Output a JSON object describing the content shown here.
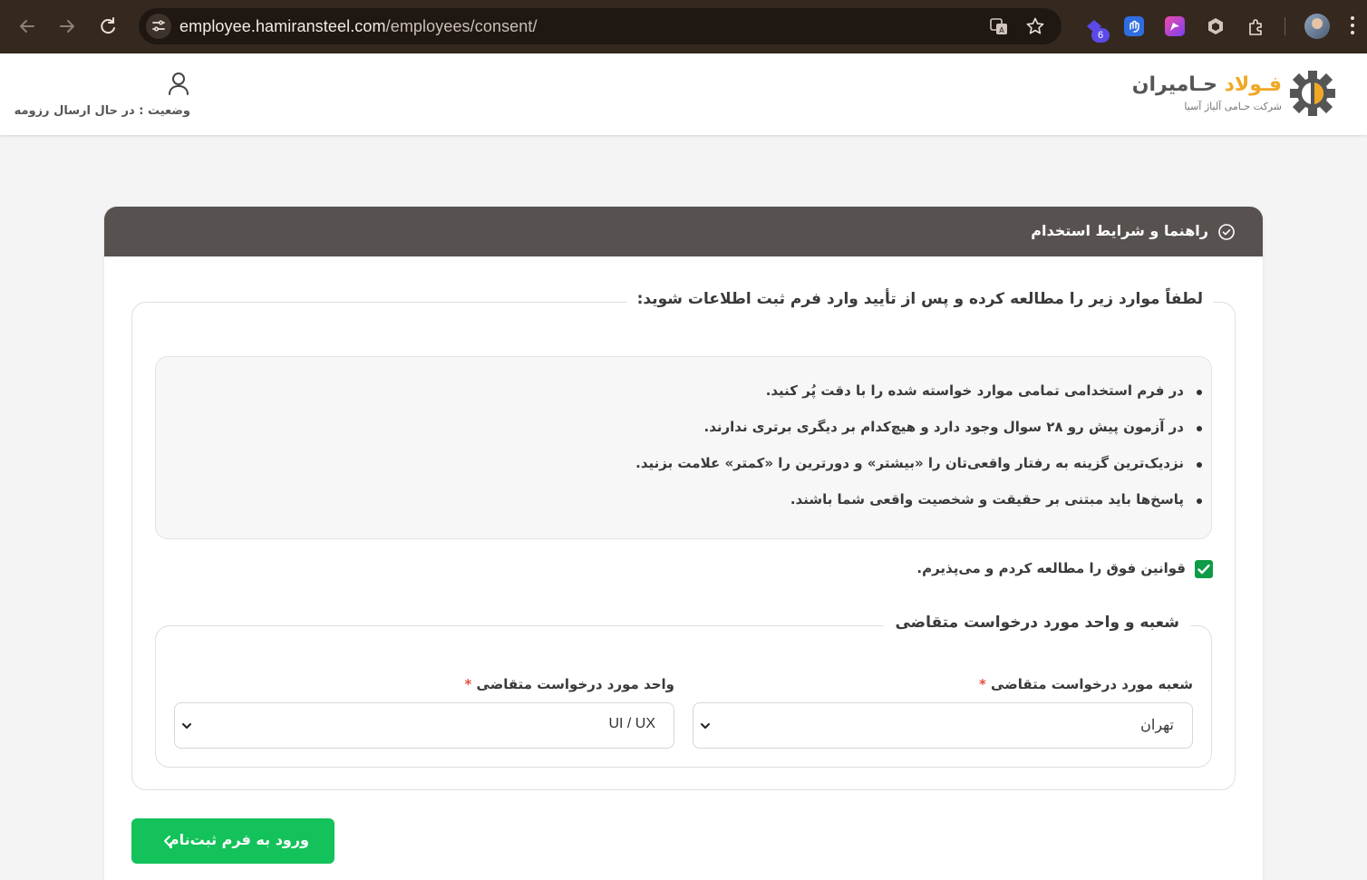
{
  "browser": {
    "url_host": "employee.hamiransteel.com",
    "url_path": "/employees/consent/",
    "extension_badge": "6"
  },
  "header": {
    "logo_title_accent": "فـولاد",
    "logo_title_rest": " حـامیران",
    "logo_subtitle": "شرکت حـامی آلیاژ آسیا",
    "user_status": "وضعیت : در حال ارسال رزومه"
  },
  "card": {
    "title": "راهنما و شرایط استخدام",
    "rules_legend": "لطفاً موارد زیر را مطالعه کرده و پس از تأیید وارد فرم ثبت اطلاعات شوید:",
    "rules": [
      "در فرم استخدامی تمامی موارد خواسته شده را با دقت پُر کنید.",
      "در آزمون پیش رو ۲۸ سوال وجود دارد و هیچ‌کدام بر دیگری برتری ندارند.",
      "نزدیک‌ترین گزینه به رفتار واقعی‌تان را «بیشتر» و دورترین را «کمتر» علامت بزنید.",
      "پاسخ‌ها باید مبتنی بر حقیقت و شخصیت واقعی شما باشند."
    ],
    "consent_label": "قوانین فوق را مطالعه کردم و می‌پذیرم.",
    "consent_checked": true,
    "branch_legend": "شعبه و واحد مورد درخواست متقاضی",
    "branch_field": {
      "label": "شعبه مورد درخواست متقاضی",
      "required_mark": "*",
      "value": "تهران"
    },
    "unit_field": {
      "label": "واحد مورد درخواست متقاضی",
      "required_mark": "*",
      "value": "UI / UX"
    },
    "submit_label": "ورود به فرم ثبت‌نام"
  },
  "colors": {
    "chrome": "#35291f",
    "card_header": "#57524f",
    "accent_green": "#13c25a",
    "logo_accent": "#f0a825"
  }
}
